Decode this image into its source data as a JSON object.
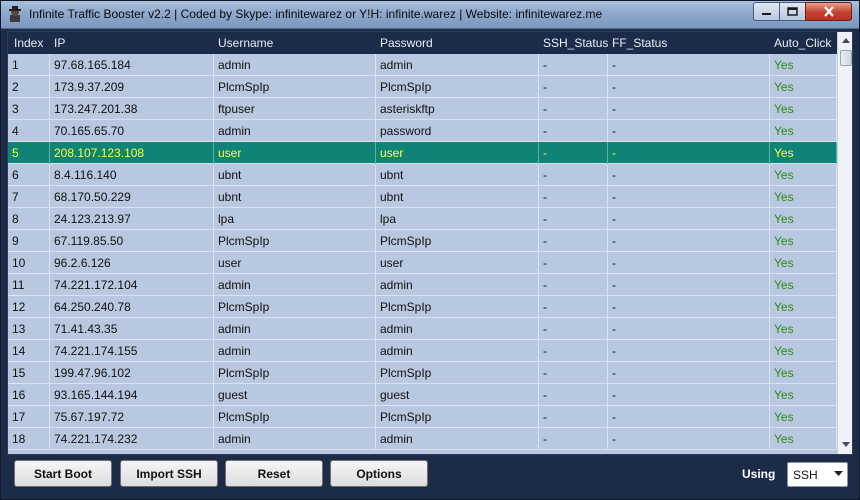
{
  "window": {
    "title": "Infinite Traffic Booster v2.2 | Coded by Skype: infinitewarez or Y!H: infinite.warez | Website: infinitewarez.me"
  },
  "columns": [
    "Index",
    "IP",
    "Username",
    "Password",
    "SSH_Status",
    "FF_Status",
    "Auto_Click"
  ],
  "rows": [
    {
      "index": "1",
      "ip": "97.68.165.184",
      "username": "admin",
      "password": "admin",
      "ssh": "-",
      "ff": "-",
      "auto": "Yes"
    },
    {
      "index": "2",
      "ip": "173.9.37.209",
      "username": "PlcmSpIp",
      "password": "PlcmSpIp",
      "ssh": "-",
      "ff": "-",
      "auto": "Yes"
    },
    {
      "index": "3",
      "ip": "173.247.201.38",
      "username": "ftpuser",
      "password": "asteriskftp",
      "ssh": "-",
      "ff": "-",
      "auto": "Yes"
    },
    {
      "index": "4",
      "ip": "70.165.65.70",
      "username": "admin",
      "password": "password",
      "ssh": "-",
      "ff": "-",
      "auto": "Yes"
    },
    {
      "index": "5",
      "ip": "208.107.123.108",
      "username": "user",
      "password": "user",
      "ssh": "-",
      "ff": "-",
      "auto": "Yes",
      "selected": true
    },
    {
      "index": "6",
      "ip": "8.4.116.140",
      "username": "ubnt",
      "password": "ubnt",
      "ssh": "-",
      "ff": "-",
      "auto": "Yes"
    },
    {
      "index": "7",
      "ip": "68.170.50.229",
      "username": "ubnt",
      "password": "ubnt",
      "ssh": "-",
      "ff": "-",
      "auto": "Yes"
    },
    {
      "index": "8",
      "ip": "24.123.213.97",
      "username": "lpa",
      "password": "lpa",
      "ssh": "-",
      "ff": "-",
      "auto": "Yes"
    },
    {
      "index": "9",
      "ip": "67.119.85.50",
      "username": "PlcmSpIp",
      "password": "PlcmSpIp",
      "ssh": "-",
      "ff": "-",
      "auto": "Yes"
    },
    {
      "index": "10",
      "ip": "96.2.6.126",
      "username": "user",
      "password": "user",
      "ssh": "-",
      "ff": "-",
      "auto": "Yes"
    },
    {
      "index": "11",
      "ip": "74.221.172.104",
      "username": "admin",
      "password": "admin",
      "ssh": "-",
      "ff": "-",
      "auto": "Yes"
    },
    {
      "index": "12",
      "ip": "64.250.240.78",
      "username": "PlcmSpIp",
      "password": "PlcmSpIp",
      "ssh": "-",
      "ff": "-",
      "auto": "Yes"
    },
    {
      "index": "13",
      "ip": "71.41.43.35",
      "username": "admin",
      "password": "admin",
      "ssh": "-",
      "ff": "-",
      "auto": "Yes"
    },
    {
      "index": "14",
      "ip": "74.221.174.155",
      "username": "admin",
      "password": "admin",
      "ssh": "-",
      "ff": "-",
      "auto": "Yes"
    },
    {
      "index": "15",
      "ip": "199.47.96.102",
      "username": "PlcmSpIp",
      "password": "PlcmSpIp",
      "ssh": "-",
      "ff": "-",
      "auto": "Yes"
    },
    {
      "index": "16",
      "ip": "93.165.144.194",
      "username": "guest",
      "password": "guest",
      "ssh": "-",
      "ff": "-",
      "auto": "Yes"
    },
    {
      "index": "17",
      "ip": "75.67.197.72",
      "username": "PlcmSpIp",
      "password": "PlcmSpIp",
      "ssh": "-",
      "ff": "-",
      "auto": "Yes"
    },
    {
      "index": "18",
      "ip": "74.221.174.232",
      "username": "admin",
      "password": "admin",
      "ssh": "-",
      "ff": "-",
      "auto": "Yes"
    }
  ],
  "buttons": {
    "start_boot": "Start Boot",
    "import_ssh": "Import SSH",
    "reset": "Reset",
    "options": "Options"
  },
  "using": {
    "label": "Using",
    "value": "SSH"
  },
  "colors": {
    "window_bg": "#1c2c48",
    "grid_bg": "#b8c8e0",
    "selected_row": "#0f8476",
    "selected_text": "#ffff40",
    "yes_text": "#2e8a12"
  },
  "icons": [
    "app-icon",
    "minimize-icon",
    "maximize-icon",
    "close-icon",
    "scroll-up-icon",
    "scroll-down-icon",
    "chevron-down-icon"
  ]
}
